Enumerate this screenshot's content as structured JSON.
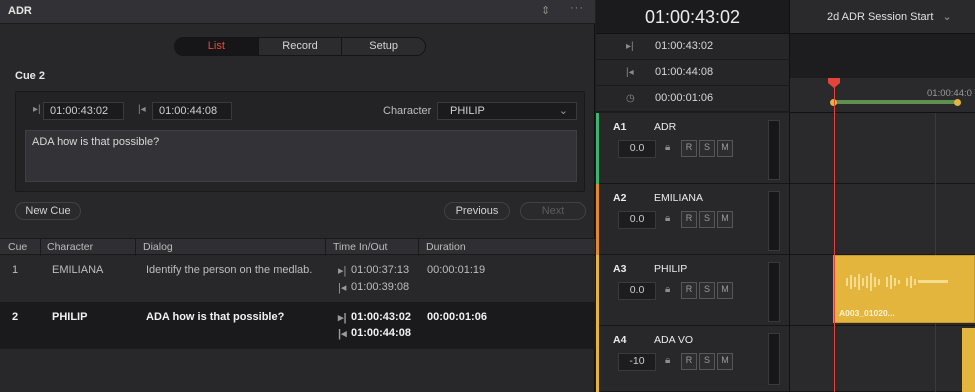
{
  "adr_panel": {
    "title": "ADR",
    "tabs": [
      {
        "label": "List",
        "active": true
      },
      {
        "label": "Record"
      },
      {
        "label": "Setup"
      }
    ],
    "cue_title": "Cue 2",
    "time_in": "01:00:43:02",
    "time_out": "01:00:44:08",
    "character_label": "Character",
    "character_value": "PHILIP",
    "dialog_text": "ADA how is that possible?",
    "new_cue_label": "New Cue",
    "previous_label": "Previous",
    "next_label": "Next",
    "table": {
      "headers": [
        "Cue",
        "Character",
        "Dialog",
        "Time In/Out",
        "Duration"
      ],
      "rows": [
        {
          "cue": "1",
          "character": "EMILIANA",
          "dialog": "Identify the person on the medlab.",
          "time_in": "01:00:37:13",
          "time_out": "01:00:39:08",
          "duration": "00:00:01:19"
        },
        {
          "cue": "2",
          "character": "PHILIP",
          "dialog": "ADA how is that possible?",
          "time_in": "01:00:43:02",
          "time_out": "01:00:44:08",
          "duration": "00:00:01:06"
        }
      ]
    }
  },
  "timeline": {
    "current_timecode": "01:00:43:02",
    "session_marker": "2d ADR Session Start",
    "in_point": "01:00:43:02",
    "out_point": "01:00:44:08",
    "duration": "00:00:01:06",
    "ruler_label": "01:00:44:0",
    "tracks": [
      {
        "index": "A1",
        "name": "ADR",
        "volume": "0.0",
        "color": "#3fb36b"
      },
      {
        "index": "A2",
        "name": "EMILIANA",
        "volume": "0.0",
        "color": "#e08a2e"
      },
      {
        "index": "A3",
        "name": "PHILIP",
        "volume": "0.0",
        "color": "#e3b53d"
      },
      {
        "index": "A4",
        "name": "ADA VO",
        "volume": "-10",
        "color": "#e3b53d"
      }
    ],
    "track_buttons": [
      "R",
      "S",
      "M"
    ],
    "clip_label": "A003_01020..."
  },
  "colors": {
    "accent_red": "#e8483c",
    "clip_yellow": "#e3b53d",
    "playhead": "#e3453b",
    "range_green": "#5e8f4f"
  },
  "icons": [
    "collapse-icon",
    "more-options-icon",
    "in-point-icon",
    "out-point-icon",
    "duration-clock-icon",
    "lock-icon",
    "chevron-down-icon"
  ]
}
